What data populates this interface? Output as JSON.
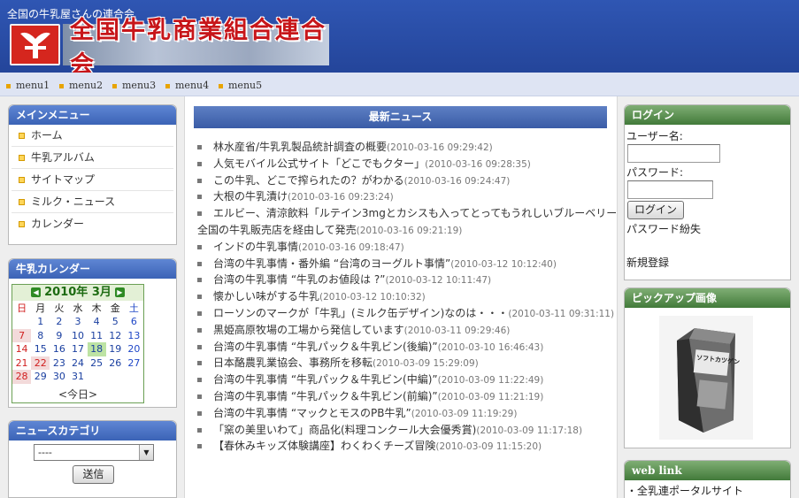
{
  "header": {
    "caption": "全国の牛乳屋さんの連合会",
    "logo_text": "全国牛乳商業組合連合会"
  },
  "menubar": {
    "items": [
      "menu1",
      "menu2",
      "menu3",
      "menu4",
      "menu5"
    ]
  },
  "main_menu": {
    "title": "メインメニュー",
    "items": [
      "ホーム",
      "牛乳アルバム",
      "サイトマップ",
      "ミルク・ニュース",
      "カレンダー"
    ]
  },
  "calendar": {
    "title": "牛乳カレンダー",
    "month_label": "2010年 3月",
    "weekdays": [
      "日",
      "月",
      "火",
      "水",
      "木",
      "金",
      "土"
    ],
    "weeks": [
      [
        "",
        "1",
        "2",
        "3",
        "4",
        "5",
        "6"
      ],
      [
        "7",
        "8",
        "9",
        "10",
        "11",
        "12",
        "13"
      ],
      [
        "14",
        "15",
        "16",
        "17",
        "18",
        "19",
        "20"
      ],
      [
        "21",
        "22",
        "23",
        "24",
        "25",
        "26",
        "27"
      ],
      [
        "28",
        "29",
        "30",
        "31",
        "",
        "",
        ""
      ]
    ],
    "today_link": "<今日>"
  },
  "news_category": {
    "title": "ニュースカテゴリ",
    "select_value": "----",
    "submit_label": "送信"
  },
  "news": {
    "title": "最新ニュース",
    "items": [
      {
        "text": "林水産省/牛乳乳製品統計調査の概要",
        "date": "(2010-03-16 09:29:42)"
      },
      {
        "text": "人気モバイル公式サイト「どこでもクター」",
        "date": "(2010-03-16 09:28:35)"
      },
      {
        "text": "この牛乳、どこで搾られたの？がわかる",
        "date": "(2010-03-16 09:24:47)"
      },
      {
        "text": "大根の牛乳漬け",
        "date": "(2010-03-16 09:23:24)"
      },
      {
        "text": "エルビー、清涼飲料「ルテイン3mgとカシスも入ってとってもうれしいブルーベリー」",
        "date": ""
      },
      {
        "text": "全国の牛乳販売店を経由して発売",
        "date": "(2010-03-16 09:21:19)"
      },
      {
        "text": "インドの牛乳事情",
        "date": "(2010-03-16 09:18:47)"
      },
      {
        "text": "台湾の牛乳事情・番外編 “台湾のヨーグルト事情”",
        "date": "(2010-03-12 10:12:40)"
      },
      {
        "text": "台湾の牛乳事情 “牛乳のお値段は ?”",
        "date": "(2010-03-12 10:11:47)"
      },
      {
        "text": "懐かしい味がする牛乳",
        "date": "(2010-03-12 10:10:32)"
      },
      {
        "text": "ローソンのマークが「牛乳」(ミルク缶デザイン)なのは・・・",
        "date": "(2010-03-11 09:31:11)"
      },
      {
        "text": "黒姫高原牧場の工場から発信しています",
        "date": "(2010-03-11 09:29:46)"
      },
      {
        "text": "台湾の牛乳事情 “牛乳パック＆牛乳ビン(後編)”",
        "date": "(2010-03-10 16:46:43)"
      },
      {
        "text": "日本酪農乳業協会、事務所を移転",
        "date": "(2010-03-09 15:29:09)"
      },
      {
        "text": "台湾の牛乳事情 “牛乳パック＆牛乳ビン(中編)”",
        "date": "(2010-03-09 11:22:49)"
      },
      {
        "text": "台湾の牛乳事情 “牛乳パック＆牛乳ビン(前編)”",
        "date": "(2010-03-09 11:21:19)"
      },
      {
        "text": "台湾の牛乳事情 “マックとモスのPB牛乳”",
        "date": "(2010-03-09 11:19:29)"
      },
      {
        "text": "「窯の美里いわて」商品化(料理コンクール大会優秀賞)",
        "date": "(2010-03-09 11:17:18)"
      },
      {
        "text": "【春休みキッズ体験講座】わくわくチーズ冒険",
        "date": "(2010-03-09 11:15:20)"
      }
    ]
  },
  "login": {
    "title": "ログイン",
    "username_label": "ユーザー名:",
    "password_label": "パスワード:",
    "username_value": "",
    "password_value": "",
    "submit_label": "ログイン",
    "forgot_link": "パスワード紛失",
    "register_link": "新規登録"
  },
  "pickup": {
    "title": "ピックアップ画像",
    "image_text": "ソフトカツゲン"
  },
  "weblink": {
    "title": "web link",
    "items": [
      "・全乳連ポータルサイト"
    ]
  },
  "colors": {
    "header_bg": "#2b4ea6",
    "logo_red": "#d5261e",
    "blue_title": "#3b63b6",
    "green_title": "#427a3a"
  }
}
